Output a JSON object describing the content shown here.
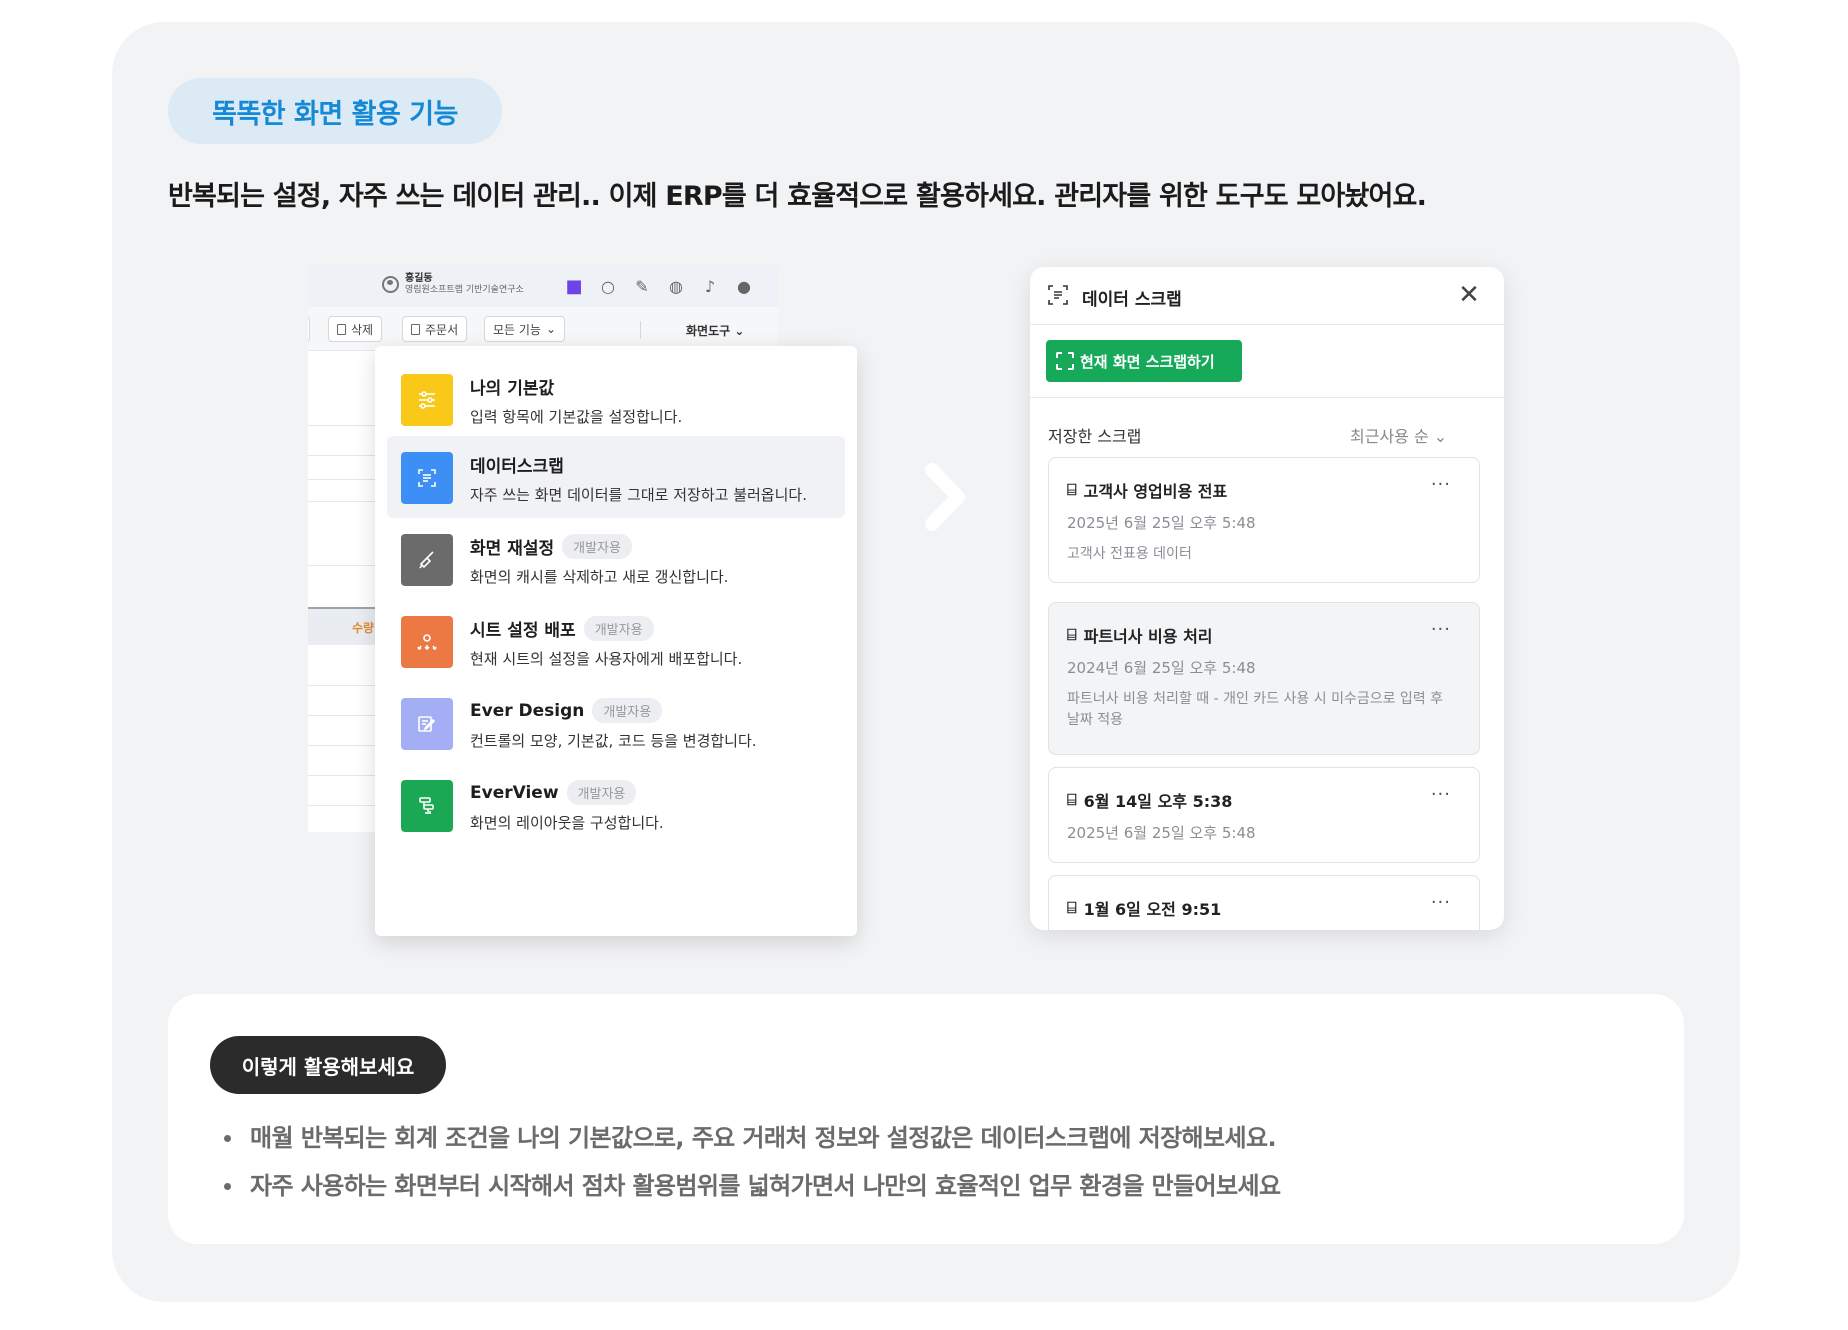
{
  "header": {
    "pill": "똑똑한 화면 활용 기능",
    "subtitle": "반복되는 설정, 자주 쓰는 데이터 관리.. 이제 ERP를 더 효율적으로 활용하세요. 관리자를 위한 도구도 모아놨어요."
  },
  "erp": {
    "user_name": "홍길동",
    "user_org": "영림원소프트랩 기반기술연구소",
    "toolbar_icons": [
      "meet-icon",
      "search-icon",
      "edit-icon",
      "globe-icon",
      "bell-icon",
      "help-icon"
    ],
    "buttons": {
      "delete": "삭제",
      "order": "주문서",
      "all": "모든 기능"
    },
    "screen_tool": "화면도구",
    "qty_header": "수량"
  },
  "menu": {
    "items": [
      {
        "title": "나의 기본값",
        "tag": "",
        "desc": "입력 항목에 기본값을 설정합니다.",
        "color": "#f9c91a",
        "icon": "sliders-icon"
      },
      {
        "title": "데이터스크랩",
        "tag": "",
        "desc": "자주 쓰는 화면 데이터를 그대로 저장하고 불러옵니다.",
        "color": "#3d8ef5",
        "icon": "scrap-icon"
      },
      {
        "title": "화면 재설정",
        "tag": "개발자용",
        "desc": "화면의 캐시를 삭제하고 새로 갱신합니다.",
        "color": "#6b6b6b",
        "icon": "broom-icon"
      },
      {
        "title": "시트 설정 배포",
        "tag": "개발자용",
        "desc": "현재 시트의 설정을 사용자에게 배포합니다.",
        "color": "#ec7843",
        "icon": "distribute-icon"
      },
      {
        "title": "Ever Design",
        "tag": "개발자용",
        "desc": "컨트롤의 모양, 기본값, 코드 등을 변경합니다.",
        "color": "#a3aef5",
        "icon": "design-icon"
      },
      {
        "title": "EverView",
        "tag": "개발자용",
        "desc": "화면의 레이아웃을 구성합니다.",
        "color": "#1aa855",
        "icon": "layout-icon"
      }
    ]
  },
  "panel": {
    "title": "데이터 스크랩",
    "capture_label": "현재 화면 스크랩하기",
    "saved_label": "저장한 스크랩",
    "sort_label": "최근사용 순",
    "scraps": [
      {
        "title": "고객사 영업비용 전표",
        "date": "2025년 6월 25일 오후 5:48",
        "desc": "고객사 전표용 데이터"
      },
      {
        "title": "파트너사 비용 처리",
        "date": "2024년 6월 25일 오후 5:48",
        "desc": "파트너사 비용 처리할 때 - 개인 카드 사용 시 미수금으로 입력 후 날짜 적용"
      },
      {
        "title": "6월 14일 오후 5:38",
        "date": "2025년 6월 25일 오후 5:48",
        "desc": ""
      },
      {
        "title": "1월 6일 오전 9:51",
        "date": "",
        "desc": ""
      }
    ]
  },
  "tips": {
    "badge": "이렇게 활용해보세요",
    "items": [
      "매월 반복되는 회계 조건을 나의 기본값으로, 주요 거래처 정보와 설정값은 데이터스크랩에 저장해보세요.",
      "자주 사용하는 화면부터 시작해서 점차 활용범위를 넓혀가면서 나만의 효율적인 업무 환경을 만들어보세요"
    ]
  },
  "colors": {
    "accent_blue": "#1489d6",
    "green": "#17a95a"
  }
}
